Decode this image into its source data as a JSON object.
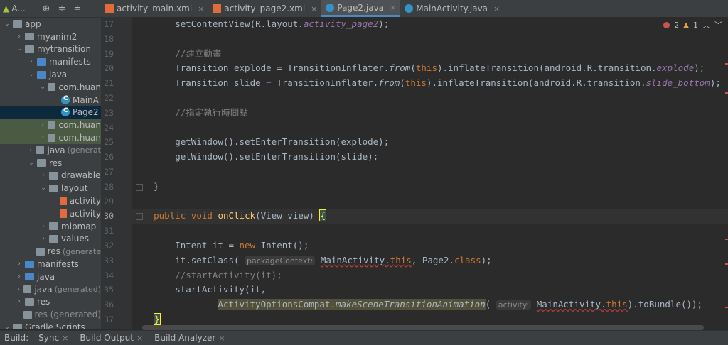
{
  "project_panel": {
    "selector_label": "A...",
    "tree": [
      {
        "label": "app",
        "depth": 0,
        "chev": "open",
        "icon": "folder"
      },
      {
        "label": "myanim2",
        "depth": 1,
        "chev": "closed",
        "icon": "folder"
      },
      {
        "label": "mytransition",
        "depth": 1,
        "chev": "open",
        "icon": "folder"
      },
      {
        "label": "manifests",
        "depth": 2,
        "chev": "closed",
        "icon": "folder-blue"
      },
      {
        "label": "java",
        "depth": 2,
        "chev": "open",
        "icon": "folder-blue"
      },
      {
        "label": "com.huan",
        "depth": 3,
        "chev": "open",
        "icon": "folder"
      },
      {
        "label": "MainA",
        "depth": 4,
        "chev": "none",
        "icon": "class"
      },
      {
        "label": "Page2",
        "depth": 4,
        "chev": "none",
        "icon": "class",
        "state": "sel"
      },
      {
        "label": "com.huan",
        "depth": 3,
        "chev": "closed",
        "icon": "folder",
        "state": "hl"
      },
      {
        "label": "com.huan",
        "depth": 3,
        "chev": "closed",
        "icon": "folder",
        "state": "hl"
      },
      {
        "label": "java",
        "suffix": "(generat",
        "depth": 2,
        "chev": "closed",
        "icon": "folder"
      },
      {
        "label": "res",
        "depth": 2,
        "chev": "open",
        "icon": "folder"
      },
      {
        "label": "drawable",
        "depth": 3,
        "chev": "closed",
        "icon": "folder"
      },
      {
        "label": "layout",
        "depth": 3,
        "chev": "open",
        "icon": "folder"
      },
      {
        "label": "activity",
        "depth": 4,
        "chev": "none",
        "icon": "xml"
      },
      {
        "label": "activity",
        "depth": 4,
        "chev": "none",
        "icon": "xml"
      },
      {
        "label": "mipmap",
        "depth": 3,
        "chev": "closed",
        "icon": "folder"
      },
      {
        "label": "values",
        "depth": 3,
        "chev": "closed",
        "icon": "folder"
      },
      {
        "label": "res",
        "suffix": "(generate",
        "depth": 2,
        "chev": "none",
        "icon": "folder"
      },
      {
        "label": "manifests",
        "depth": 1,
        "chev": "closed",
        "icon": "folder-blue"
      },
      {
        "label": "java",
        "depth": 1,
        "chev": "closed",
        "icon": "folder-blue"
      },
      {
        "label": "java",
        "suffix": "(generated)",
        "depth": 1,
        "chev": "closed",
        "icon": "folder"
      },
      {
        "label": "res",
        "depth": 1,
        "chev": "closed",
        "icon": "folder"
      },
      {
        "label": "res (generated)",
        "depth": 1,
        "chev": "none",
        "icon": "folder",
        "dim": true
      },
      {
        "label": "Gradle Scripts",
        "depth": 0,
        "chev": "open",
        "icon": "folder"
      }
    ]
  },
  "tabs": [
    {
      "label": "activity_main.xml",
      "icon": "xml",
      "active": false
    },
    {
      "label": "activity_page2.xml",
      "icon": "xml",
      "active": false
    },
    {
      "label": "Page2.java",
      "icon": "class",
      "active": true
    },
    {
      "label": "MainActivity.java",
      "icon": "class",
      "active": false
    }
  ],
  "indicators": {
    "errors": "2",
    "warnings": "1"
  },
  "line_numbers": [
    "17",
    "18",
    "19",
    "20",
    "21",
    "22",
    "23",
    "24",
    "25",
    "26",
    "27",
    "28",
    "29",
    "30",
    "31",
    "32",
    "33",
    "34",
    "35",
    "36",
    "37"
  ],
  "current_line": "30",
  "bottom_bar": {
    "build_label": "Build:",
    "tabs": [
      "Sync",
      "Build Output",
      "Build Analyzer"
    ]
  },
  "colors": {
    "keyword": "#cc7832",
    "field": "#9876aa",
    "comment": "#808080",
    "accent": "#4a88c7"
  }
}
